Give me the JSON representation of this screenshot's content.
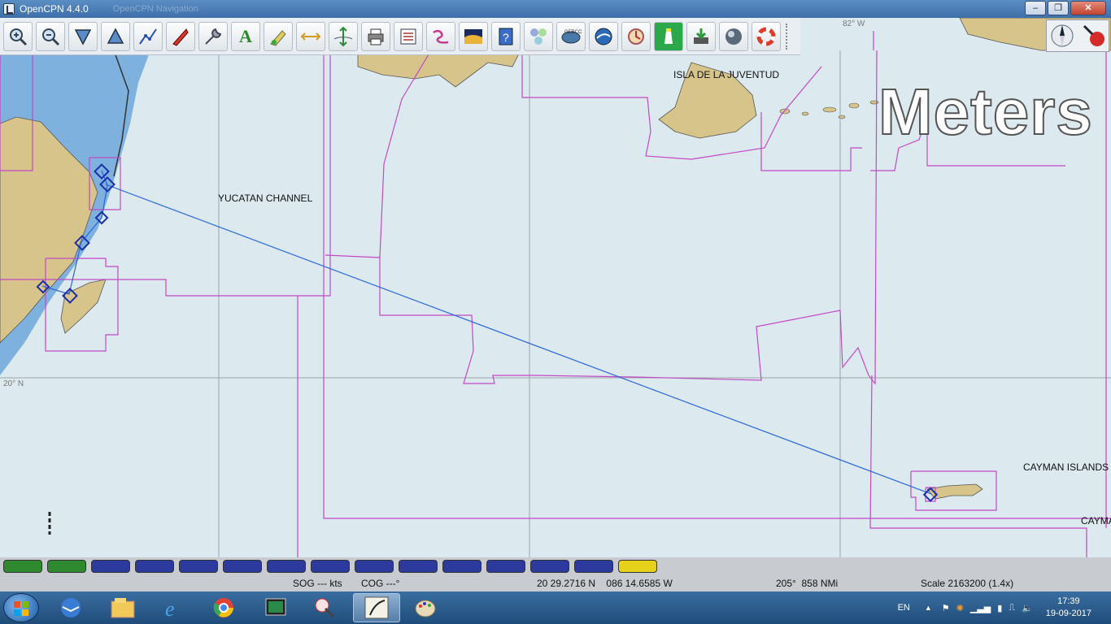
{
  "window": {
    "title": "OpenCPN 4.4.0",
    "ghost_tab": "OpenCPN Navigation",
    "minimize": "–",
    "maximize": "❐",
    "close": "✕"
  },
  "toolbar": {
    "buttons": [
      "zoom-in",
      "zoom-out",
      "scale-in",
      "scale-out",
      "route",
      "track",
      "settings",
      "text",
      "mob-mark",
      "tide",
      "current",
      "print",
      "route-manager",
      "wiki",
      "chart-quilt",
      "help",
      "layers",
      "gebco",
      "google-earth",
      "aisview",
      "lighthouse",
      "download",
      "weather",
      "lifebuoy"
    ]
  },
  "chart": {
    "units_overlay": "Meters",
    "places": {
      "isla": "ISLA DE LA JUVENTUD",
      "yucatan": "YUCATAN CHANNEL",
      "cayman": "CAYMAN ISLANDS",
      "cayman_cut": "CAYMA"
    },
    "grid": {
      "lat_label": "20° N",
      "lon_label": "82° W"
    }
  },
  "piano_keys": {
    "colors": {
      "raster": "#2f8a2f",
      "vector": "#2c3a9e",
      "cm93": "#e6d21a"
    }
  },
  "status": {
    "sog": "SOG --- kts",
    "cog": "COG ---°",
    "position": "20 29.2716 N    086 14.6585 W",
    "bearing": "205°  858 NMi",
    "scale": "Scale 2163200 (1.4x)"
  },
  "taskbar": {
    "language": "EN",
    "time": "17:39",
    "date": "19-09-2017"
  }
}
